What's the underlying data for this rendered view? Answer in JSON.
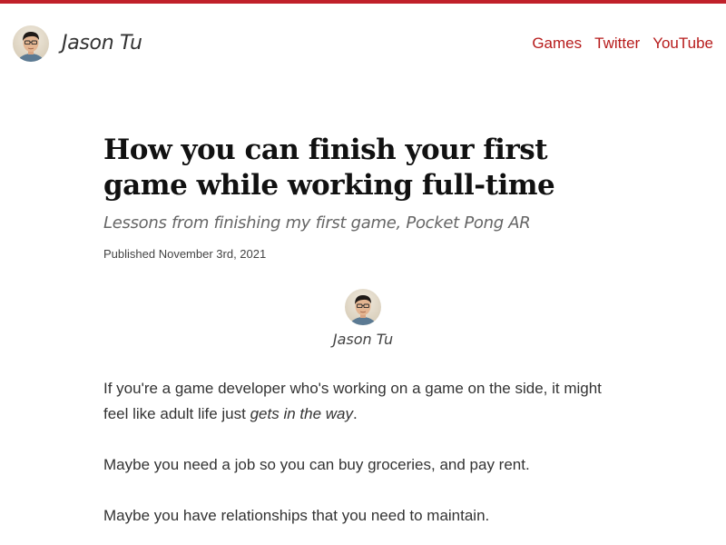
{
  "colors": {
    "accent": "#c0202a",
    "link": "#b71c1c",
    "title": "#111111",
    "text": "#333333",
    "muted": "#666666"
  },
  "header": {
    "site_title": "Jason Tu",
    "avatar_icon": "author-avatar-photo",
    "nav": [
      {
        "label": "Games"
      },
      {
        "label": "Twitter"
      },
      {
        "label": "YouTube"
      }
    ]
  },
  "post": {
    "title": "How you can finish your first game while working full-time",
    "subtitle": "Lessons from finishing my first game, Pocket Pong AR",
    "published": "Published November 3rd, 2021",
    "author": {
      "name": "Jason Tu",
      "avatar_icon": "author-avatar-photo"
    },
    "paragraphs": [
      {
        "text_before": "If you're a game developer who's working on a game on the side, it might feel like adult life just ",
        "emphasis": "gets in the way",
        "text_after": "."
      },
      {
        "text": "Maybe you need a job so you can buy groceries, and pay rent."
      },
      {
        "text": "Maybe you have relationships that you need to maintain."
      }
    ]
  }
}
